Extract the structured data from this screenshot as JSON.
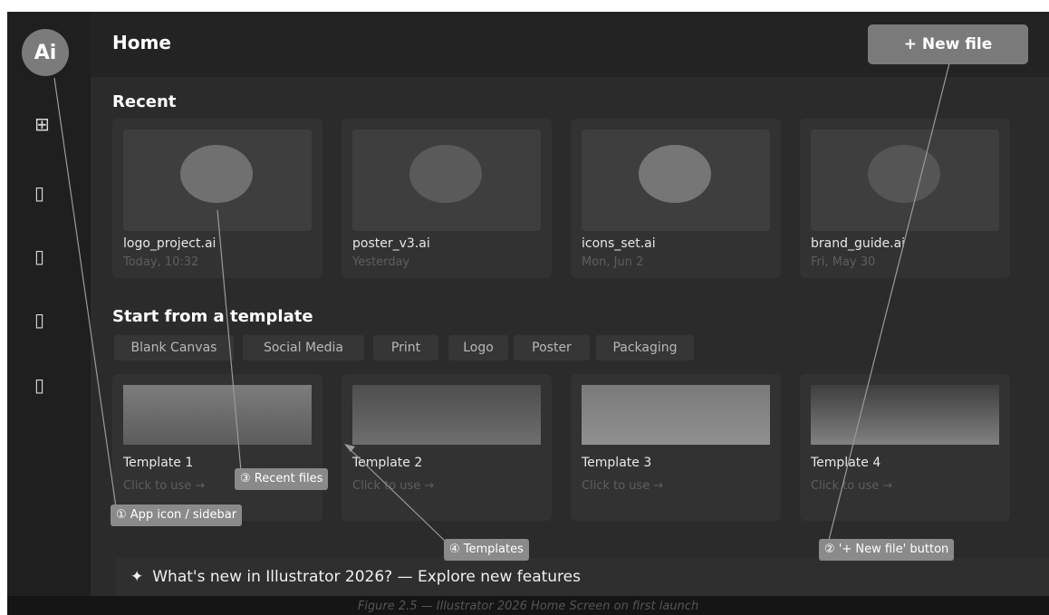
{
  "sidebar": {
    "app_icon_label": "Ai",
    "icons": [
      {
        "name": "grid-icon",
        "glyph": "⊞"
      },
      {
        "name": "placeholder-icon",
        "glyph": "▯"
      },
      {
        "name": "placeholder-icon",
        "glyph": "▯"
      },
      {
        "name": "placeholder-icon",
        "glyph": "▯"
      },
      {
        "name": "placeholder-icon",
        "glyph": "▯"
      }
    ]
  },
  "header": {
    "title": "Home",
    "new_file_label": "+ New file"
  },
  "recent": {
    "title": "Recent",
    "items": [
      {
        "name": "logo_project.ai",
        "date": "Today, 10:32"
      },
      {
        "name": "poster_v3.ai",
        "date": "Yesterday"
      },
      {
        "name": "icons_set.ai",
        "date": "Mon, Jun 2"
      },
      {
        "name": "brand_guide.ai",
        "date": "Fri, May 30"
      }
    ]
  },
  "templates": {
    "title": "Start from a template",
    "categories": [
      "Blank Canvas",
      "Social Media",
      "Print",
      "Logo",
      "Poster",
      "Packaging"
    ],
    "items": [
      {
        "name": "Template 1",
        "action": "Click to use →"
      },
      {
        "name": "Template 2",
        "action": "Click to use →"
      },
      {
        "name": "Template 3",
        "action": "Click to use →"
      },
      {
        "name": "Template 4",
        "action": "Click to use →"
      }
    ]
  },
  "whats_new": {
    "star": "✦",
    "text": "What's new in Illustrator 2026?  —  Explore new features"
  },
  "caption": "Figure 2.5 — Illustrator 2026 Home Screen on first launch",
  "callouts": {
    "app_icon": "① App icon / sidebar",
    "new_file": "② '+ New file' button",
    "recent": "③ Recent files",
    "templates": "④ Templates"
  },
  "colors": {
    "background": "#1c1c1c",
    "panel": "#2b2b2b",
    "card": "#323232",
    "accent_button": "#7a7a7a"
  }
}
